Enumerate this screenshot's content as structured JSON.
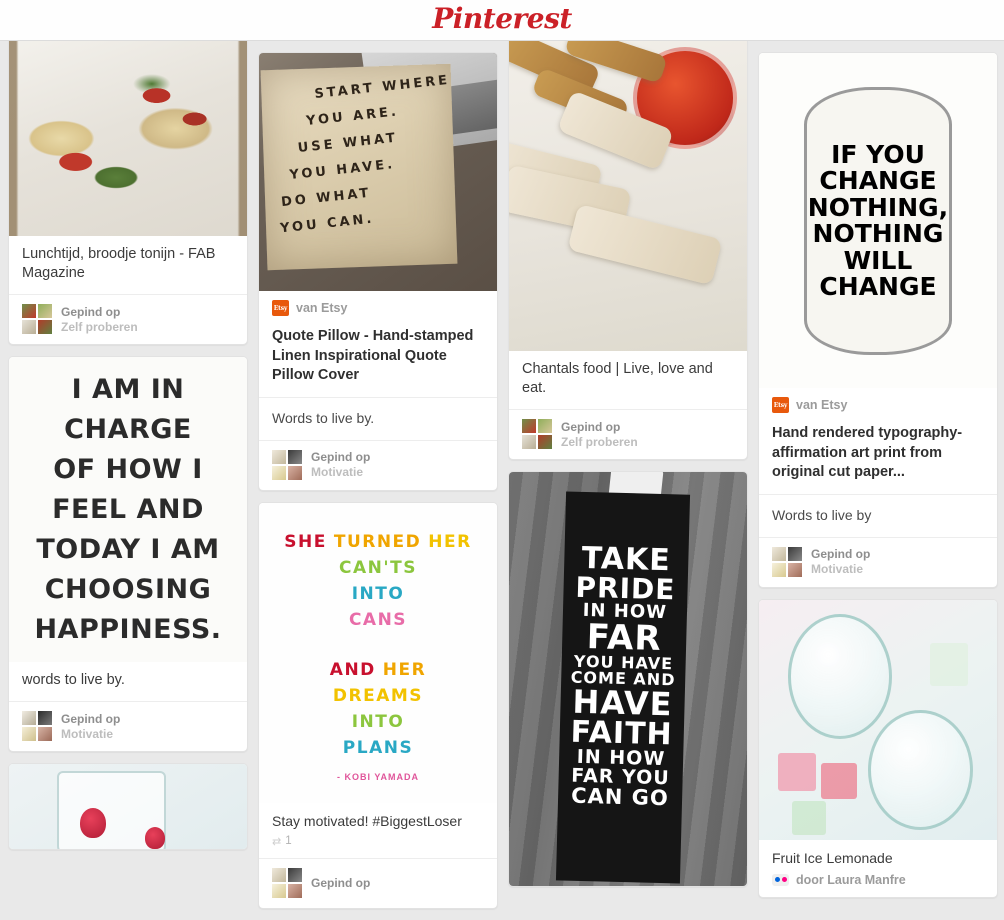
{
  "header": {
    "logo_text": "Pinterest"
  },
  "attribution_labels": {
    "pinned_on": "Gepind op",
    "board_zelf_proberen": "Zelf proberen",
    "board_motivatie": "Motivatie",
    "by": "door",
    "source_etsy": "van Etsy"
  },
  "columns": [
    {
      "id": "column-1",
      "pins": [
        {
          "id": "pin-lunchtijd-broodje-tonijn",
          "title": "Lunchtijd, broodje tonijn - FAB Magazine",
          "attrib_line1": "Gepind op",
          "attrib_line2": "Zelf proberen",
          "image_alt": "tuna sandwiches with tomato and red onion on white plate"
        },
        {
          "id": "pin-i-am-in-charge",
          "description": "words to live by.",
          "attrib_line1": "Gepind op",
          "attrib_line2": "Motivatie",
          "artwork_lines": [
            "I AM IN",
            "CHARGE",
            "OF HOW I",
            "FEEL AND",
            "TODAY I AM",
            "CHOOSING",
            "HAPPINESS."
          ]
        },
        {
          "id": "pin-berry-ice-drink",
          "image_alt": "glass with strawberry ice cubes"
        }
      ]
    },
    {
      "id": "column-2",
      "pins": [
        {
          "id": "pin-quote-pillow",
          "source": "van Etsy",
          "source_badge": "etsy-badge",
          "title": "Quote Pillow - Hand-stamped Linen Inspirational Quote Pillow Cover",
          "description": "Words to live by.",
          "attrib_line1": "Gepind op",
          "attrib_line2": "Motivatie",
          "artwork_lines": [
            "START WHERE",
            "YOU ARE.",
            "USE WHAT",
            "YOU HAVE.",
            "DO WHAT",
            "YOU CAN."
          ]
        },
        {
          "id": "pin-she-turned-her-cants",
          "title": "Stay motivated! #BiggestLoser",
          "repin_count": "1",
          "attrib_line1": "Gepind op",
          "artwork_lines": [
            {
              "text": "SHE",
              "color": "#c8102e"
            },
            {
              "text": "TURNED",
              "color": "#f0a500"
            },
            {
              "text": "HER",
              "color": "#f2c200"
            },
            {
              "text": "CAN'TS",
              "color": "#8cc63e"
            },
            {
              "text": "INTO",
              "color": "#29a8c4"
            },
            {
              "text": "CANS",
              "color": "#e86ca8"
            },
            {
              "text": "AND",
              "color": "#c8102e"
            },
            {
              "text": "HER",
              "color": "#f0a500"
            },
            {
              "text": "DREAMS",
              "color": "#f2c200"
            },
            {
              "text": "INTO",
              "color": "#8cc63e"
            },
            {
              "text": "PLANS",
              "color": "#29a8c4"
            }
          ],
          "artwork_author": "- KOBI YAMADA"
        }
      ]
    },
    {
      "id": "column-3",
      "pins": [
        {
          "id": "pin-chantals-food",
          "title": "Chantals food | Live, love and eat.",
          "attrib_line1": "Gepind op",
          "attrib_line2": "Zelf proberen",
          "image_alt": "breaded baked sticks with red dipping sauce on white plate"
        },
        {
          "id": "pin-take-pride",
          "artwork_lines": [
            "TAKE",
            "PRIDE",
            "IN HOW",
            "FAR",
            "YOU HAVE",
            "COME AND",
            "HAVE",
            "FAITH",
            "IN HOW",
            "FAR YOU",
            "CAN GO"
          ]
        }
      ]
    },
    {
      "id": "column-4",
      "pins": [
        {
          "id": "pin-hand-rendered-typography",
          "source": "van Etsy",
          "source_badge": "etsy-badge",
          "title": "Hand rendered typography-affirmation art print from original cut paper...",
          "description": "Words to live by",
          "attrib_line1": "Gepind op",
          "attrib_line2": "Motivatie",
          "artwork_lines": [
            {
              "text": "IF YOU",
              "color": "#b4413c"
            },
            {
              "text": "CHANGE",
              "color": "#5f9e3f"
            },
            {
              "text": "NOTHING,",
              "color": "#3a6fa8"
            },
            {
              "text": "NOTHING",
              "color": "#8b85d0"
            },
            {
              "text": "WILL",
              "color": "#c08a2e"
            },
            {
              "text": "CHANGE",
              "color": "#a8382f"
            }
          ]
        },
        {
          "id": "pin-fruit-ice-lemonade",
          "title": "Fruit Ice Lemonade",
          "source_badge": "flickr-badge",
          "by_line": "door Laura Manfre",
          "image_alt": "two glasses of lemonade with fruit ice cubes"
        }
      ]
    }
  ],
  "colors": {
    "brand_red": "#cb2027",
    "page_bg": "#e9e9e9",
    "card_bg": "#ffffff",
    "etsy_orange": "#e8590c"
  }
}
